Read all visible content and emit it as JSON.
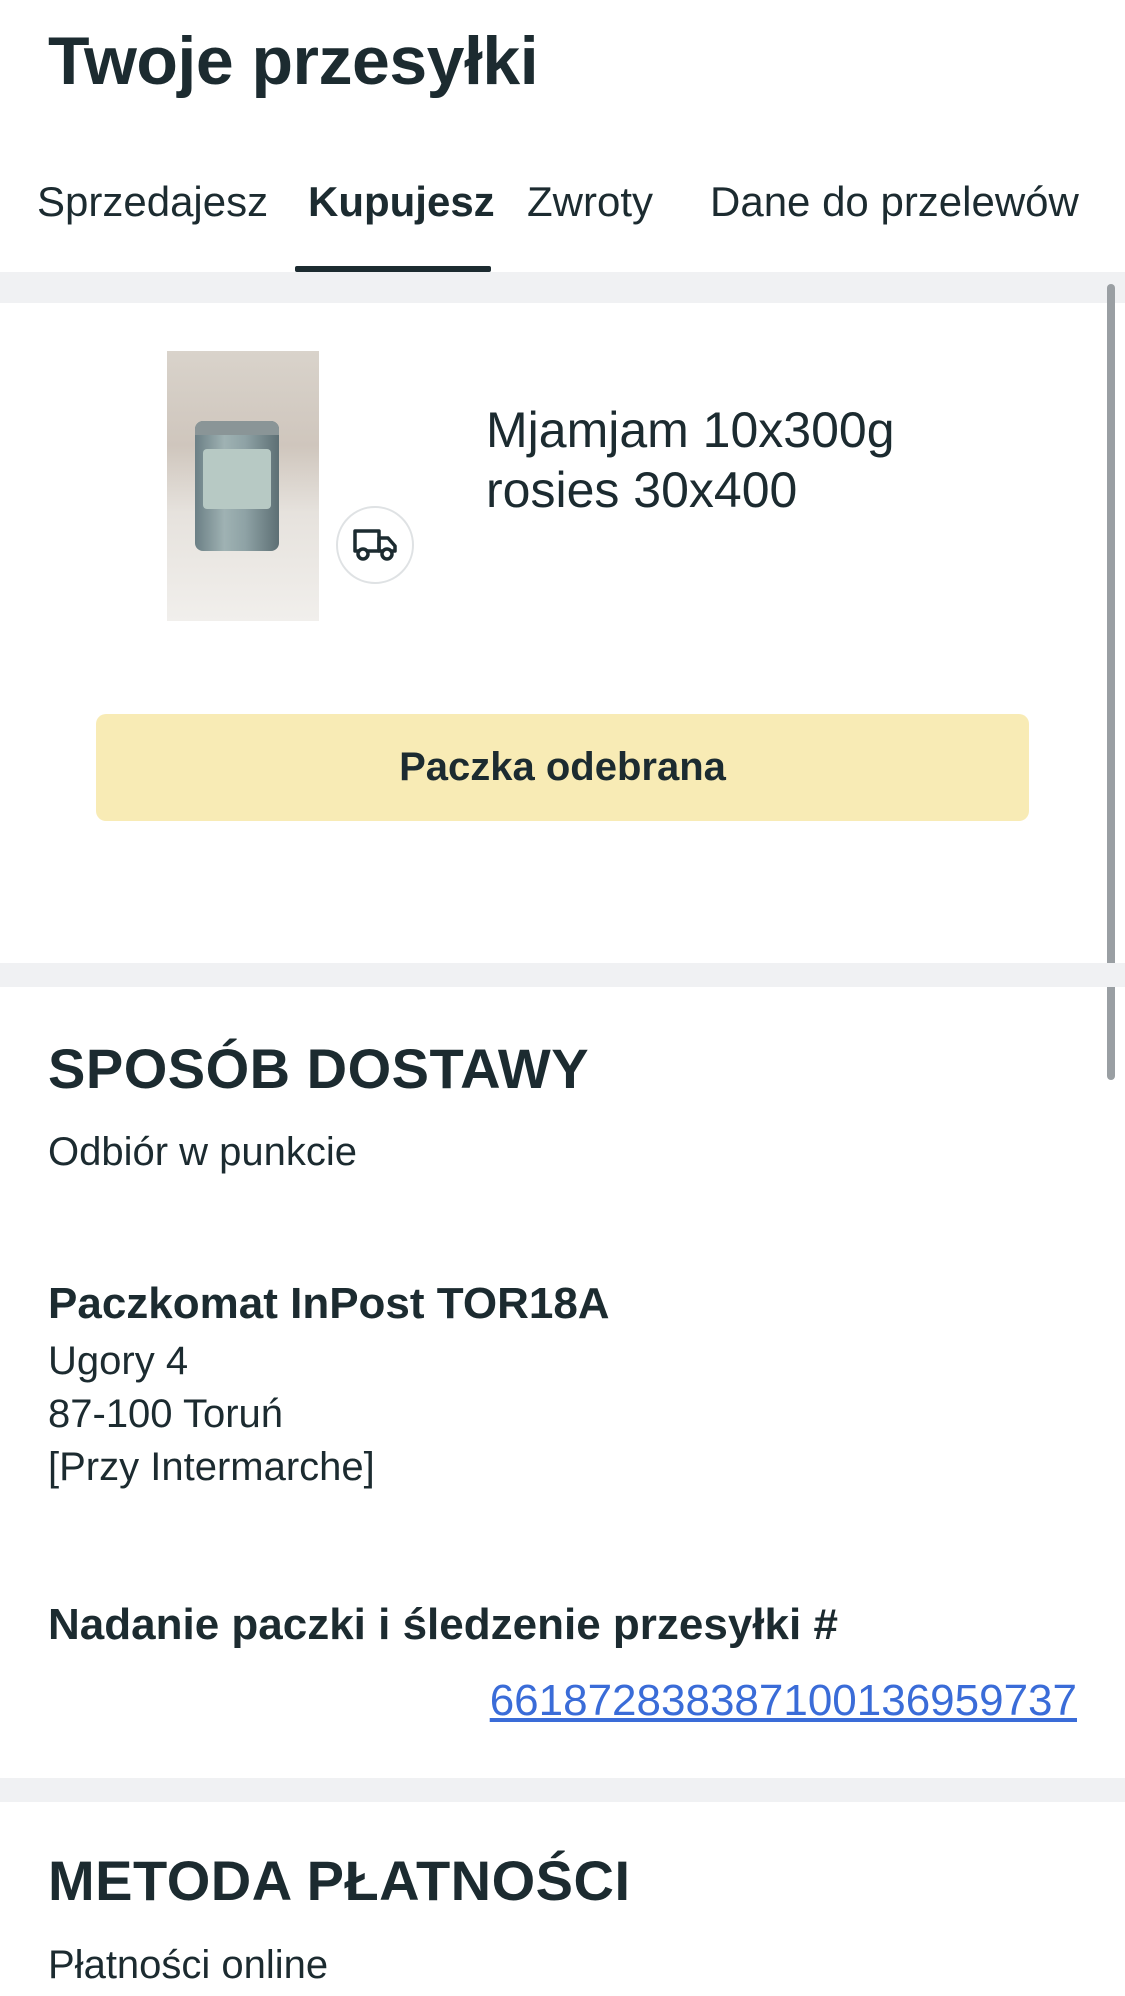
{
  "page": {
    "title": "Twoje przesyłki"
  },
  "tabs": [
    {
      "label": "Sprzedajesz",
      "active": false
    },
    {
      "label": "Kupujesz",
      "active": true
    },
    {
      "label": "Zwroty",
      "active": false
    },
    {
      "label": "Dane do przelewów",
      "active": false
    }
  ],
  "product": {
    "name_line1": "Mjamjam 10x300g",
    "name_line2": "rosies 30x400",
    "status_icon": "truck-icon",
    "status_button": "Paczka odebrana"
  },
  "delivery": {
    "heading": "SPOSÓB DOSTAWY",
    "method": "Odbiór w punkcie",
    "point_name": "Paczkomat InPost TOR18A",
    "address_street": "Ugory 4",
    "address_city": "87-100 Toruń",
    "address_note": "[Przy Intermarche]",
    "tracking_label": "Nadanie paczki i śledzenie przesyłki #",
    "tracking_number": "661872838387100136959737"
  },
  "payment": {
    "heading": "METODA PŁATNOŚCI",
    "method": "Płatności online"
  },
  "colors": {
    "text": "#1c2b30",
    "status_bg": "#f8ebb5",
    "link": "#3a6cd8",
    "section_gap": "#f0f1f3"
  }
}
